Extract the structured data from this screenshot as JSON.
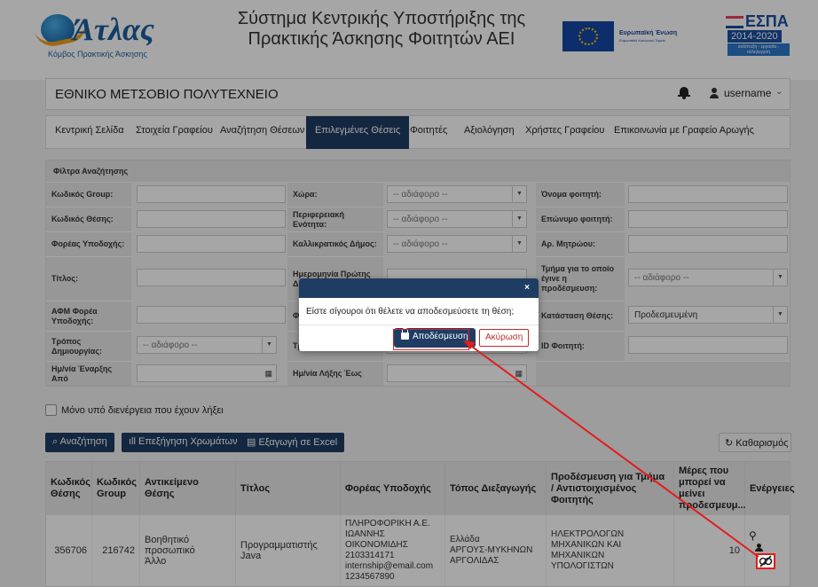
{
  "header": {
    "logo_text": "Άτλας",
    "logo_sub": "Κόμβος Πρακτικής Άσκησης",
    "title_line1": "Σύστημα Κεντρικής Υποστήριξης της",
    "title_line2": "Πρακτικής Άσκησης Φοιτητών ΑΕΙ",
    "eu_label": "Ευρωπαϊκή Ένωση",
    "eu_sub": "Ευρωπαϊκό Κοινωνικό Ταμείο",
    "espa_title": "ΕΣΠΑ",
    "espa_years": "2014-2020",
    "espa_slogan": "ανάπτυξη - εργασία - αλληλεγγύη"
  },
  "institution": {
    "name": "ΕΘΝΙΚΟ ΜΕΤΣΟΒΙΟ ΠΟΛΥΤΕΧΝΕΙΟ",
    "username": "username"
  },
  "nav": {
    "tabs": [
      "Κεντρική Σελίδα",
      "Στοιχεία Γραφείου",
      "Αναζήτηση Θέσεων",
      "Επιλεγμένες Θέσεις",
      "Φοιτητές",
      "Αξιολόγηση",
      "Χρήστες Γραφείου",
      "Επικοινωνία με Γραφείο Αρωγής"
    ],
    "active": "Επιλεγμένες Θέσεις"
  },
  "filters": {
    "title": "Φίλτρα Αναζήτησης",
    "group_code": "Κωδικός Group:",
    "position_code": "Κωδικός Θέσης:",
    "host": "Φορέας Υποδοχής:",
    "title_label": "Τίτλος:",
    "afm": "ΑΦΜ Φορέα Υποδοχής:",
    "creation": "Τρόπος Δημιουργίας:",
    "start_from": "Ημ/νία Έναρξης Από",
    "country": "Χώρα:",
    "region": "Περιφερειακή Ενότητα:",
    "municipality": "Καλλικρατικός Δήμος:",
    "first_date": "Ημερομηνία Πρώτης Δη",
    "fu": "Φυ",
    "financing": "Τρ Χρηματοδότησης:",
    "end_to": "Ημ/νία Λήξης Έως",
    "student_name": "Όνομα φοιτητή:",
    "student_surname": "Επώνυμο φοιτητή:",
    "am": "Αρ. Μητρώου:",
    "dept": "Τμήμα για το οποίο έγινε η προδέσμευση:",
    "status": "Κατάσταση Θέσης:",
    "student_id": "ID Φοιτητή:",
    "any": "-- αδιάφορο --",
    "status_value": "Προδεσμευμένη"
  },
  "options": {
    "expired_only": "Μόνο υπό διενέργεια που έχουν λήξει"
  },
  "toolbar": {
    "search": "Αναζήτηση",
    "colors": "Επεξήγηση Χρωμάτων",
    "excel": "Εξαγωγή σε Excel",
    "clear": "Καθαρισμός"
  },
  "table": {
    "headers": [
      "Κωδικός Θέσης",
      "Κωδικός Group",
      "Αντικείμενο Θέσης",
      "Τίτλος",
      "Φορέας Υποδοχής",
      "Τόπος Διεξαγωγής",
      "Προδέσμευση για Τμήμα / Αντιστοιχισμένος Φοιτητής",
      "Μέρες που μπορεί να μείνει προδεσμευμ...",
      "Ενέργειες"
    ],
    "row": {
      "code": "356706",
      "group": "216742",
      "subject1": "Βοηθητικό προσωπικό",
      "subject2": "Άλλο",
      "title": "Προγραμματιστής Java",
      "host1": "ΠΛΗΡΟΦΟΡΙΚΗ Α.Ε.",
      "host2": "ΙΩΑΝΝΗΣ ΟΙΚΟΝΟΜΙΔΗΣ",
      "host3": "2103314171",
      "host4": "internship@email.com",
      "host5": "1234567890",
      "place1": "Ελλάδα",
      "place2": "ΑΡΓΟΥΣ-ΜΥΚΗΝΩΝ",
      "place3": "ΑΡΓΟΛΙΔΑΣ",
      "dept1": "ΗΛΕΚΤΡΟΛΟΓΩΝ",
      "dept2": "ΜΗΧΑΝΙΚΩΝ ΚΑΙ ΜΗΧΑΝΙΚΩΝ",
      "dept3": "ΥΠΟΛΟΓΙΣΤΩΝ",
      "days": "10"
    }
  },
  "modal": {
    "close": "×",
    "message": "Είστε σίγουροι ότι θέλετε να αποδεσμεύσετε τη θέση;",
    "confirm": "Αποδέσμευση",
    "cancel": "Ακύρωση"
  },
  "colors": {
    "primary": "#1f3d63",
    "danger": "#c62828",
    "highlight": "#e31c1c"
  }
}
